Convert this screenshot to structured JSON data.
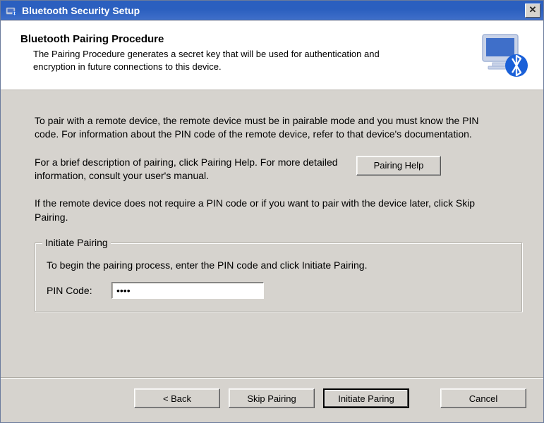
{
  "window": {
    "title": "Bluetooth Security Setup"
  },
  "banner": {
    "title": "Bluetooth Pairing Procedure",
    "description": "The Pairing Procedure generates a secret key that will be used for authentication and encryption in future connections to this device."
  },
  "body": {
    "para1": "To pair with a remote device, the remote device must be in pairable mode and you must know the PIN code.  For information about the PIN code of the remote device, refer to that device's documentation.",
    "para2": "For a brief description of pairing, click Pairing Help.  For more detailed information, consult your user's manual.",
    "para3": "If the remote device does not require a PIN code or if you want to pair with the device later, click Skip Pairing.",
    "pairing_help_label": "Pairing Help"
  },
  "group": {
    "legend": "Initiate Pairing",
    "instruction": "To begin the pairing process, enter the PIN code and click Initiate Pairing.",
    "pin_label": "PIN Code:",
    "pin_value": "••••"
  },
  "footer": {
    "back": "< Back",
    "skip": "Skip Pairing",
    "initiate": "Initiate Paring",
    "cancel": "Cancel"
  }
}
